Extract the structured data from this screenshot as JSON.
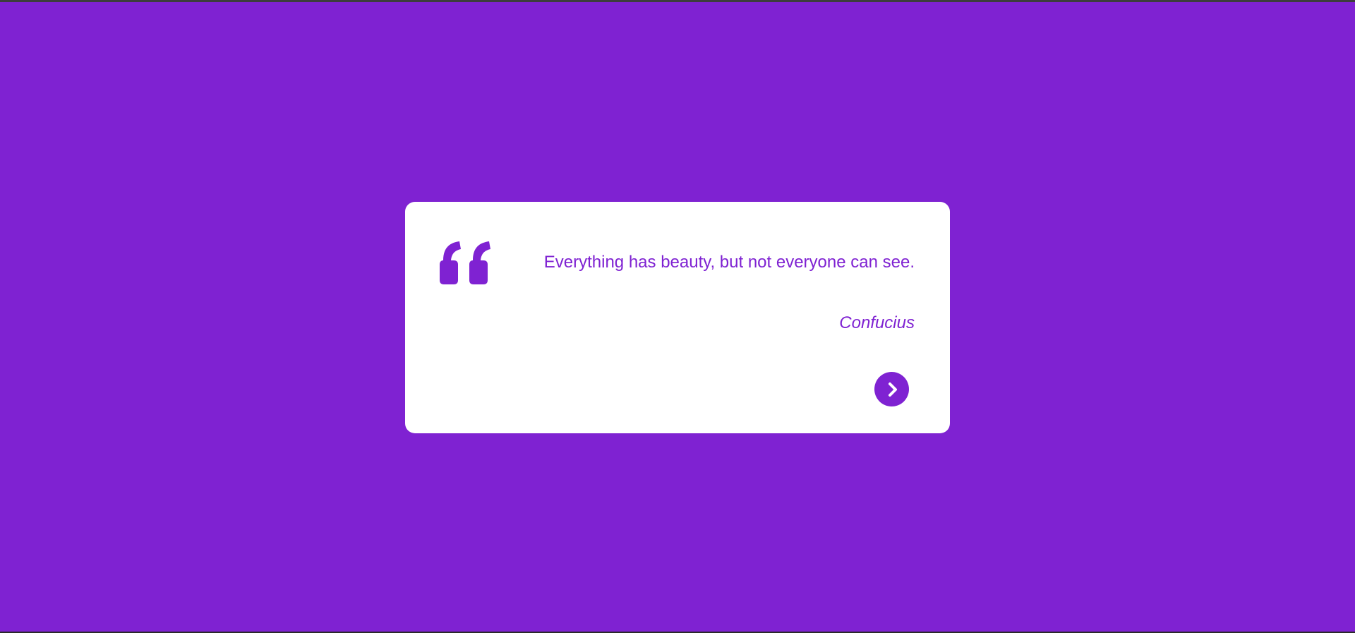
{
  "theme": {
    "background": "#7f22d2",
    "card_background": "#ffffff",
    "accent": "#7f22d2"
  },
  "quote": {
    "icon": "quote-left-icon",
    "text": "Everything has beauty, but not everyone can see.",
    "author": "Confucius"
  },
  "controls": {
    "next_icon": "chevron-right-icon"
  }
}
